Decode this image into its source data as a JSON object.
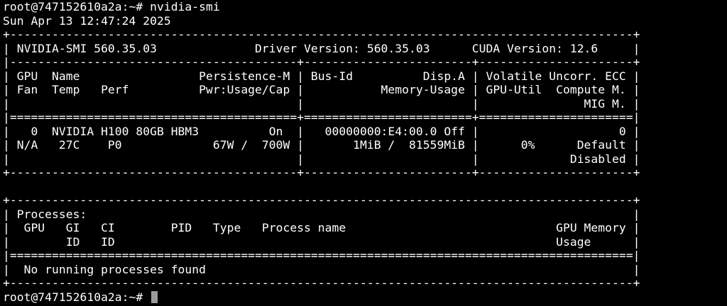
{
  "prompt": "root@747152610a2a:~# ",
  "command": "nvidia-smi",
  "timestamp": "Sun Apr 13 12:47:24 2025",
  "colors": {
    "background": "#000000",
    "text": "#ffffff",
    "cursor": "#9a9a9a"
  },
  "gpu_table": {
    "border_top": "+-----------------------------------------------------------------------------------------+",
    "header": "| NVIDIA-SMI 560.35.03              Driver Version: 560.35.03      CUDA Version: 12.6     |",
    "sep_header": "|-----------------------------------------+------------------------+----------------------+",
    "col_row1": "| GPU  Name                 Persistence-M | Bus-Id          Disp.A | Volatile Uncorr. ECC |",
    "col_row2": "| Fan  Temp   Perf          Pwr:Usage/Cap |           Memory-Usage | GPU-Util  Compute M. |",
    "col_row3": "|                                         |                        |               MIG M. |",
    "sep_double": "|=========================================+========================+======================|",
    "gpu0_row1": "|   0  NVIDIA H100 80GB HBM3          On  |   00000000:E4:00.0 Off |                    0 |",
    "gpu0_row2": "| N/A   27C    P0             67W /  700W |       1MiB /  81559MiB |      0%      Default |",
    "gpu0_row3": "|                                         |                        |             Disabled |",
    "border_bottom": "+-----------------------------------------+------------------------+----------------------+"
  },
  "proc_table": {
    "border_top": "+-----------------------------------------------------------------------------------------+",
    "title": "| Processes:                                                                              |",
    "col_row1": "|  GPU   GI   CI        PID   Type   Process name                              GPU Memory |",
    "col_row2": "|        ID   ID                                                               Usage      |",
    "sep_double": "|=========================================================================================|",
    "message": "|  No running processes found                                                             |",
    "border_bottom": "+-----------------------------------------------------------------------------------------+"
  }
}
